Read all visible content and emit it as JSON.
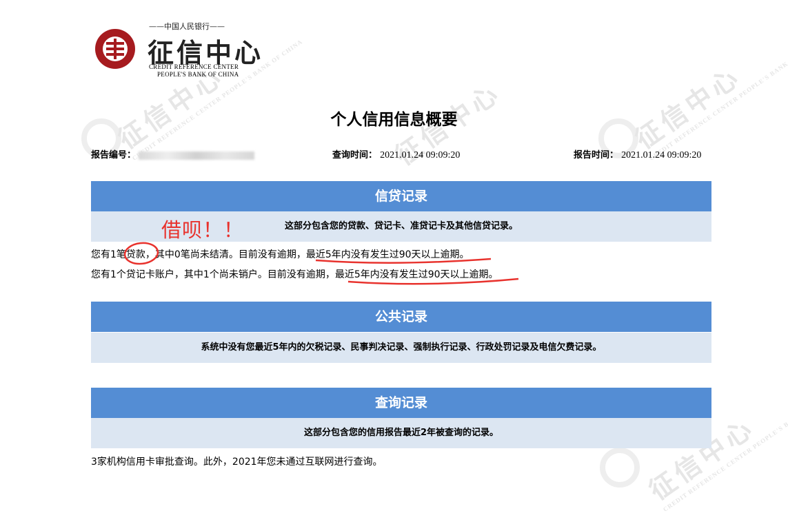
{
  "logo": {
    "top_line": "——中国人民银行——",
    "name_cn": "征信中心",
    "name_en_line1": "CREDIT REFERENCE CENTER",
    "name_en_line2": "PEOPLE'S BANK OF CHINA"
  },
  "watermark": {
    "text_cn": "征信中心",
    "text_en": "CREDIT REFERENCE CENTER PEOPLE'S BANK OF CHINA"
  },
  "report": {
    "title": "个人信用信息概要",
    "report_no_label": "报告编号：",
    "query_time_label": "查询时间：",
    "query_time": "2021.01.24 09:09:20",
    "report_time_label": "报告时间：",
    "report_time": "2021.01.24 09:09:20"
  },
  "sections": {
    "credit": {
      "header": "信贷记录",
      "desc": "这部分包含您的贷款、贷记卡、准贷记卡及其他信贷记录。",
      "line1_a": "您有1笔贷款，其中0笔尚未结清。目前没有逾期，",
      "line1_b": "最近5年内没有发生过90天以上逾期。",
      "line2_a": "您有1个贷记卡账户，其中1个尚未销户。目前没有逾期，",
      "line2_b": "最近5年内没有发生过90天以上逾期。"
    },
    "public": {
      "header": "公共记录",
      "desc": "系统中没有您最近5年内的欠税记录、民事判决记录、强制执行记录、行政处罚记录及电信欠费记录。"
    },
    "query": {
      "header": "查询记录",
      "desc": "这部分包含您的信用报告最近2年被查询的记录。",
      "line1": "3家机构信用卡审批查询。此外，2021年您未通过互联网进行查询。"
    }
  },
  "annotation": {
    "text": "借呗！！",
    "color": "#e8322d"
  },
  "colors": {
    "section_header_bg": "#548dd4",
    "section_desc_bg": "#dce6f2",
    "logo_red": "#a61b1f"
  }
}
